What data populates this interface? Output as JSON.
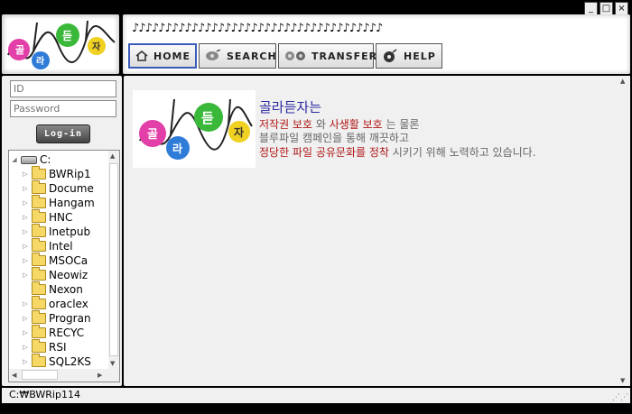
{
  "window": {
    "controls": [
      "_",
      "□",
      "×"
    ]
  },
  "header": {
    "notes": "♪♪♪♪♪♪♪♪♪♪♪♪♪♪♪♪♪♪♪♪♪♪♪♪♪♪♪♪♪♪♪♪♪♪♪♪♪♪",
    "nav": [
      {
        "label": "HOME",
        "icon": "home-icon"
      },
      {
        "label": "SEARCH",
        "icon": "search-icon"
      },
      {
        "label": "TRANSFER",
        "icon": "transfer-icon"
      },
      {
        "label": "HELP",
        "icon": "help-icon"
      }
    ]
  },
  "sidebar": {
    "id_placeholder": "ID",
    "password_placeholder": "Password",
    "login_label": "Log-in",
    "tree": {
      "root": "C:",
      "items": [
        "BWRip1",
        "Docume",
        "Hangam",
        "HNC",
        "Inetpub",
        "Intel",
        "MSOCa",
        "Neowiz",
        "Nexon",
        "oraclex",
        "Progran",
        "RECYC",
        "RSI",
        "SQL2KS"
      ]
    }
  },
  "main": {
    "title": "골라듣자는",
    "line1": {
      "a": "저작권 보호",
      "b": " 와 ",
      "c": "사생활 보호",
      "d": " 는 물론"
    },
    "line2": "블루파일 캠페인을 통해 깨끗하고",
    "line3": {
      "a": "정당한 파일 공유문화를 정착",
      "b": " 시키기 위해 노력하고 있습니다."
    }
  },
  "status": {
    "path": "C:₩BWRip114"
  },
  "colors": {
    "title": "#2a2aa0",
    "highlight": "#b01818",
    "active_nav_border": "#3a5bb8"
  }
}
